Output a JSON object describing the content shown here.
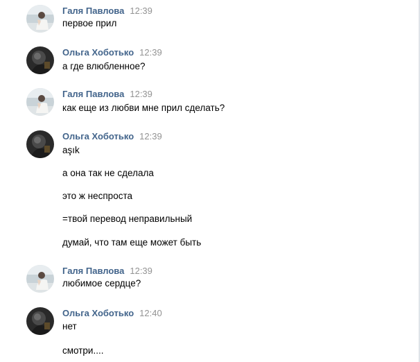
{
  "messages": [
    {
      "author": "Галя Павлова",
      "time": "12:39",
      "avatar": "woman-photo",
      "lines": [
        "первое прил"
      ]
    },
    {
      "author": "Ольга Хоботько",
      "time": "12:39",
      "avatar": "dark-photo",
      "lines": [
        "а где влюбленное?"
      ]
    },
    {
      "author": "Галя Павлова",
      "time": "12:39",
      "avatar": "woman-photo",
      "lines": [
        "как еще из любви мне прил сделать?"
      ]
    },
    {
      "author": "Ольга Хоботько",
      "time": "12:39",
      "avatar": "dark-photo",
      "lines": [
        "aşık",
        "а она так не сделала",
        "это ж неспроста",
        "=твой перевод неправильный",
        "думай, что там еще может быть"
      ]
    },
    {
      "author": "Галя Павлова",
      "time": "12:39",
      "avatar": "woman-photo",
      "lines": [
        "любимое сердце?"
      ]
    },
    {
      "author": "Ольга Хоботько",
      "time": "12:40",
      "avatar": "dark-photo",
      "lines": [
        "нет",
        "смотри...."
      ]
    }
  ],
  "colors": {
    "author": "#42648b",
    "time": "#939393",
    "text": "#000000"
  }
}
